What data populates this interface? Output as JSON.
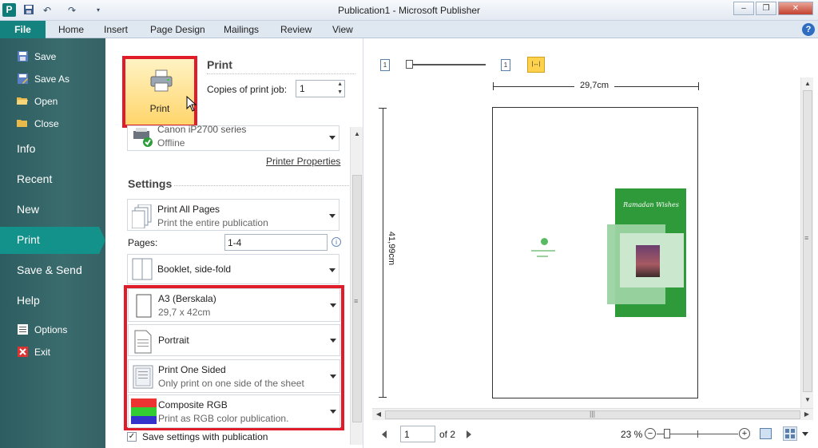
{
  "window": {
    "title": "Publication1 - Microsoft Publisher",
    "app_logo": "P"
  },
  "quick_access": {
    "icons": [
      "save-icon",
      "undo-icon",
      "redo-icon",
      "customize-icon"
    ]
  },
  "window_controls": {
    "minimize": "–",
    "restore": "❐",
    "close": "✕"
  },
  "ribbon": {
    "file_tab": "File",
    "tabs": [
      "Home",
      "Insert",
      "Page Design",
      "Mailings",
      "Review",
      "View"
    ],
    "help": "?"
  },
  "nav": {
    "small_items": [
      {
        "label": "Save",
        "icon": "save-icon"
      },
      {
        "label": "Save As",
        "icon": "save-as-icon"
      },
      {
        "label": "Open",
        "icon": "open-folder-icon"
      },
      {
        "label": "Close",
        "icon": "close-folder-icon"
      }
    ],
    "big_items": [
      "Info",
      "Recent",
      "New",
      "Print",
      "Save & Send",
      "Help"
    ],
    "selected": "Print",
    "bottom_items": [
      {
        "label": "Options",
        "icon": "options-icon"
      },
      {
        "label": "Exit",
        "icon": "exit-icon"
      }
    ]
  },
  "print": {
    "button_label": "Print",
    "header": "Print",
    "copies_label": "Copies of print job:",
    "copies_value": "1",
    "printer_name": "Canon iP2700 series",
    "printer_status": "Offline",
    "printer_properties_link": "Printer Properties"
  },
  "settings": {
    "header": "Settings",
    "range": {
      "title": "Print All Pages",
      "desc": "Print the entire publication"
    },
    "pages_label": "Pages:",
    "pages_value": "1-4",
    "layout": {
      "title": "Booklet, side-fold"
    },
    "paper": {
      "title": "A3 (Berskala)",
      "desc": "29,7 x 42cm"
    },
    "orientation": {
      "title": "Portrait"
    },
    "sides": {
      "title": "Print One Sided",
      "desc": "Only print on one side of the sheet"
    },
    "color": {
      "title": "Composite RGB",
      "desc": "Print as RGB color publication."
    },
    "save_settings_label": "Save settings with publication",
    "save_settings_checked": true
  },
  "preview": {
    "width_label": "29,7cm",
    "height_label": "41,99cm",
    "cover_title": "Ramadan Wishes",
    "page_num": "1",
    "page_of": "of 2",
    "zoom": "23 %",
    "top_page_icon_1": "1",
    "top_page_icon_2": "1"
  }
}
